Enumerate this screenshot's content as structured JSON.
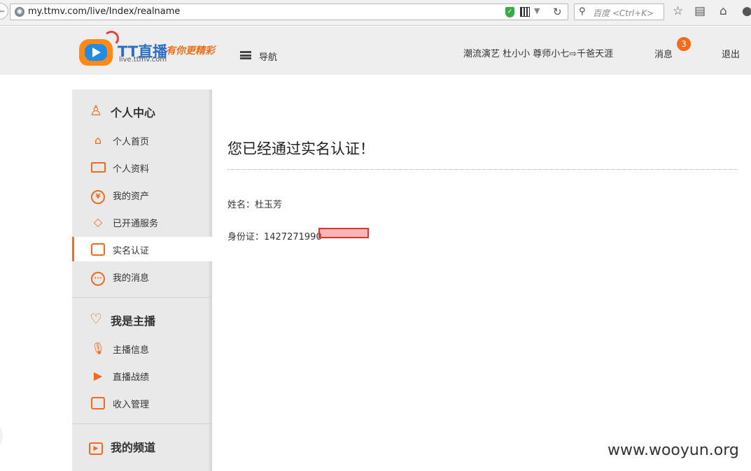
{
  "browser": {
    "url": "my.ttmv.com/live/Index/realname",
    "search_placeholder": "百度 <Ctrl+K>"
  },
  "header": {
    "logo_name": "TT直播",
    "logo_slogan": "有你更精彩",
    "logo_domain": "live.ttmv.com",
    "nav_label": "导航",
    "user_name": "潮流演艺 杜小小 尊师小七⇨千爸天涯",
    "messages_label": "消息",
    "messages_count": "3",
    "logout_label": "退出"
  },
  "sidebar": {
    "sections": [
      {
        "title": "个人中心",
        "icon": "user-icon",
        "items": [
          {
            "label": "个人首页",
            "icon": "home-icon"
          },
          {
            "label": "个人资料",
            "icon": "id-card-icon"
          },
          {
            "label": "我的资产",
            "icon": "yen-coin-icon"
          },
          {
            "label": "已开通服务",
            "icon": "diamond-icon"
          },
          {
            "label": "实名认证",
            "icon": "certificate-icon",
            "active": true
          },
          {
            "label": "我的消息",
            "icon": "chat-bubble-icon"
          }
        ]
      },
      {
        "title": "我是主播",
        "icon": "heart-icon",
        "items": [
          {
            "label": "主播信息",
            "icon": "microphone-icon"
          },
          {
            "label": "直播战绩",
            "icon": "video-camera-icon"
          },
          {
            "label": "收入管理",
            "icon": "wallet-icon"
          }
        ]
      },
      {
        "title": "我的频道",
        "icon": "play-channel-icon",
        "items": []
      }
    ]
  },
  "main": {
    "title": "您已经通过实名认证！",
    "name_label": "姓名：",
    "name_value": "杜玉芳",
    "id_label": "身份证：",
    "id_value_visible": "1427271990"
  },
  "watermark": "www.wooyun.org",
  "colors": {
    "accent": "#f26a1b",
    "header_bg": "#eeeeee",
    "sidebar_bg": "#e9e9e9",
    "logo_blue": "#2e6fc4",
    "redaction": "#e8312f"
  }
}
